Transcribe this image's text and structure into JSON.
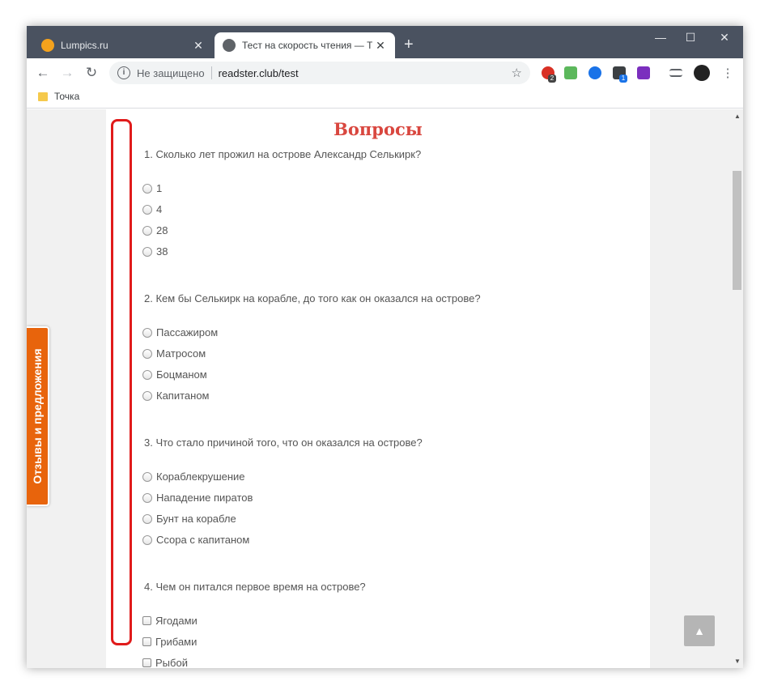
{
  "tabs": [
    {
      "title": "Lumpics.ru",
      "close": "✕",
      "favicon_color": "#f4a21d"
    },
    {
      "title": "Тест на скорость чтения — Тре",
      "close": "✕"
    }
  ],
  "new_tab": "+",
  "window_controls": {
    "minimize": "—",
    "maximize": "☐",
    "close": "✕"
  },
  "toolbar": {
    "back": "←",
    "forward": "→",
    "reload": "↻",
    "security_label": "Не защищено",
    "url": "readster.club/test",
    "info_icon": "i",
    "star": "☆",
    "menu": "⋮"
  },
  "extension_badges": [
    "2",
    "1"
  ],
  "bookmarks": [
    {
      "label": "Точка"
    }
  ],
  "page": {
    "heading": "Вопросы",
    "questions": [
      {
        "text": "1. Сколько лет прожил на острове Александр Селькирк?",
        "type": "radio",
        "options": [
          "1",
          "4",
          "28",
          "38"
        ]
      },
      {
        "text": "2. Кем бы Селькирк на корабле, до того как он оказался на острове?",
        "type": "radio",
        "options": [
          "Пассажиром",
          "Матросом",
          "Боцманом",
          "Капитаном"
        ]
      },
      {
        "text": "3. Что стало причиной того, что он оказался на острове?",
        "type": "radio",
        "options": [
          "Кораблекрушение",
          "Нападение пиратов",
          "Бунт на корабле",
          "Ссора с капитаном"
        ]
      },
      {
        "text": "4. Чем он питался первое время на острове?",
        "type": "checkbox",
        "options": [
          "Ягодами",
          "Грибами",
          "Рыбой"
        ]
      }
    ]
  },
  "feedback_tab": "Отзывы и предложения",
  "scroll_top_button": "▲",
  "colors": {
    "heading": "#d9473f",
    "feedback_bg": "#e8640c",
    "highlight": "#e01b1b"
  }
}
